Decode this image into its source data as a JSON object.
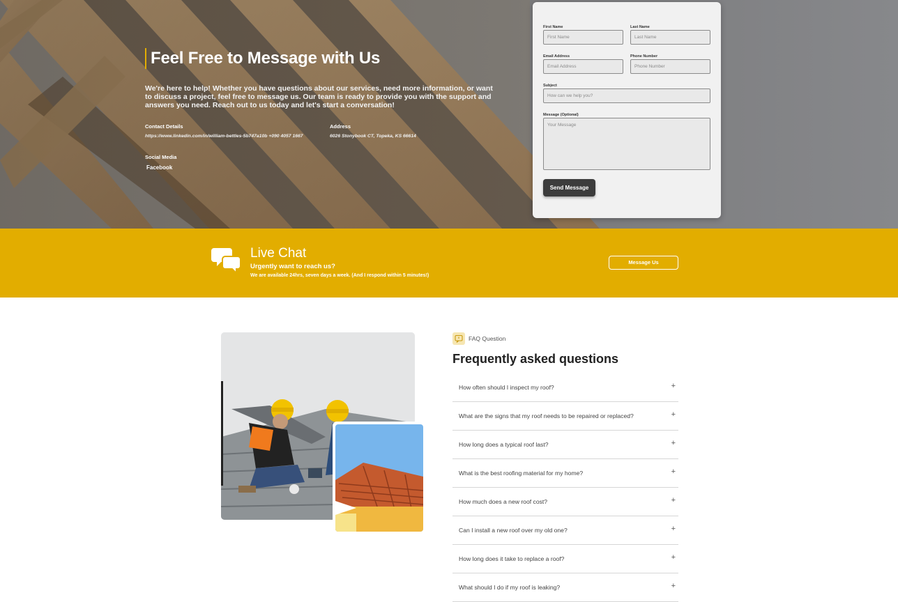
{
  "hero": {
    "title": "Feel Free to Message with Us",
    "description": "We're here to help! Whether you have questions about our services, need more information, or want to discuss a project, feel free to message us. Our team is ready to provide you with the support and answers you need. Reach out to us today and let's start a conversation!",
    "contact_label": "Contact Details",
    "contact_value": "https://www.linkedin.com/in/william-bettles-5b747a10b +090 4057 1667",
    "address_label": "Address",
    "address_value": "6026 Stonybook CT, Topeka, KS 66614",
    "social_label": "Social Media",
    "social_link": "Facebook"
  },
  "form": {
    "first_name_label": "First Name",
    "first_name_placeholder": "First Name",
    "last_name_label": "Last Name",
    "last_name_placeholder": "Last Name",
    "email_label": "Email Address",
    "email_placeholder": "Email Address",
    "phone_label": "Phone Number",
    "phone_placeholder": "Phone Number",
    "subject_label": "Subject",
    "subject_placeholder": "How can we help you?",
    "message_label": "Message (Optional)",
    "message_placeholder": "Your Message",
    "send_label": "Send Message"
  },
  "live_chat": {
    "title": "Live Chat",
    "subtitle": "Urgently want to reach us?",
    "note": "We are available 24hrs, seven days a week. (And I respond within 5 minutes!)",
    "button": "Message Us"
  },
  "faq": {
    "tag": "FAQ Question",
    "title": "Frequently asked questions",
    "items": [
      {
        "q": "How often should I inspect my roof?"
      },
      {
        "q": "What are the signs that my roof needs to be repaired or replaced?"
      },
      {
        "q": "How long does a typical roof last?"
      },
      {
        "q": "What is the best roofing material for my home?"
      },
      {
        "q": "How much does a new roof cost?"
      },
      {
        "q": "Can I install a new roof over my old one?"
      },
      {
        "q": "How long does it take to replace a roof?"
      },
      {
        "q": "What should I do if my roof is leaking?"
      }
    ]
  },
  "colors": {
    "accent": "#e2ad00",
    "dark_button": "#3c3c3c"
  }
}
